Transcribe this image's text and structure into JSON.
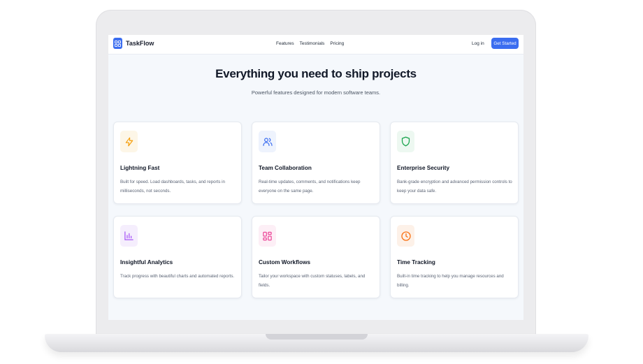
{
  "nav": {
    "brand": "TaskFlow",
    "links": [
      "Features",
      "Testimonials",
      "Pricing"
    ],
    "login": "Log in",
    "cta": "Get Started"
  },
  "hero": {
    "title": "Everything you need to ship projects",
    "subtitle": "Powerful features designed for modern software teams."
  },
  "features": [
    {
      "title": "Lightning Fast",
      "description": "Built for speed. Load dashboards, tasks, and reports in milliseconds, not seconds.",
      "icon": "lightning-icon",
      "color": "#f59e0b",
      "bg": "#fdf6e7"
    },
    {
      "title": "Team Collaboration",
      "description": "Real-time updates, comments, and notifications keep everyone on the same page.",
      "icon": "users-icon",
      "color": "#3b6df0",
      "bg": "#eef3fd"
    },
    {
      "title": "Enterprise Security",
      "description": "Bank-grade encryption and advanced permission controls to keep your data safe.",
      "icon": "shield-icon",
      "color": "#16a34a",
      "bg": "#edf8f1"
    },
    {
      "title": "Insightful Analytics",
      "description": "Track progress with beautiful charts and automated reports.",
      "icon": "bar-chart-icon",
      "color": "#a855f7",
      "bg": "#f5eefd"
    },
    {
      "title": "Custom Workflows",
      "description": "Tailor your workspace with custom statuses, labels, and fields.",
      "icon": "layout-icon",
      "color": "#ec4899",
      "bg": "#fdeff6"
    },
    {
      "title": "Time Tracking",
      "description": "Built-in time tracking to help you manage resources and billing.",
      "icon": "clock-icon",
      "color": "#f97316",
      "bg": "#fdf1e8"
    }
  ]
}
